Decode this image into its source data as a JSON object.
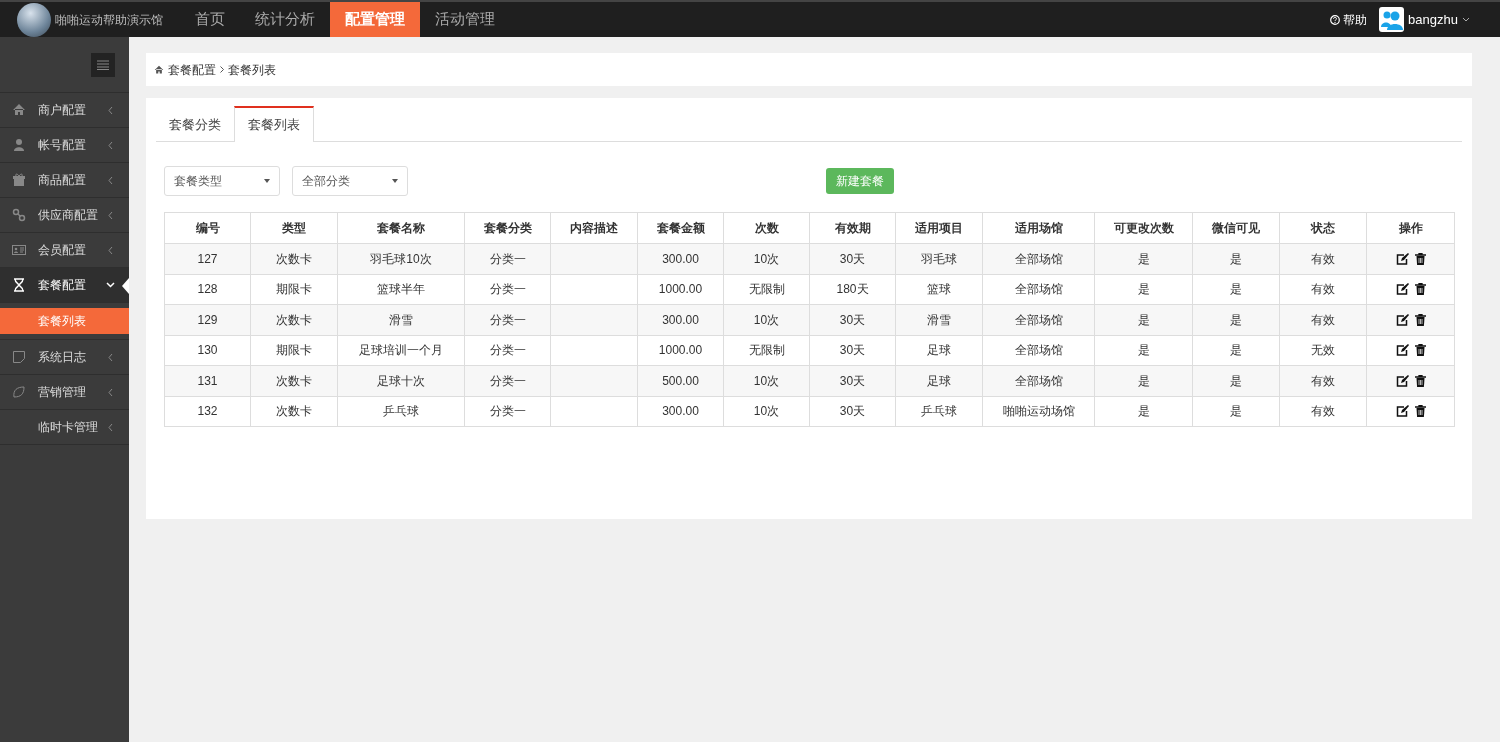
{
  "header": {
    "site_name": "啪啪运动帮助演示馆",
    "nav": [
      {
        "label": "首页",
        "selected": false
      },
      {
        "label": "统计分析",
        "selected": false
      },
      {
        "label": "配置管理",
        "selected": true
      },
      {
        "label": "活动管理",
        "selected": false
      }
    ],
    "help": "帮助",
    "user": "bangzhu"
  },
  "sidebar": {
    "items": [
      {
        "label": "商户配置",
        "expanded": false
      },
      {
        "label": "帐号配置",
        "expanded": false
      },
      {
        "label": "商品配置",
        "expanded": false
      },
      {
        "label": "供应商配置",
        "expanded": false
      },
      {
        "label": "会员配置",
        "expanded": false
      },
      {
        "label": "套餐配置",
        "expanded": true,
        "children": [
          {
            "label": "套餐列表",
            "selected": true
          }
        ]
      },
      {
        "label": "系统日志",
        "expanded": false
      },
      {
        "label": "营销管理",
        "expanded": false
      },
      {
        "label": "临时卡管理",
        "expanded": false
      }
    ]
  },
  "breadcrumb": [
    "套餐配置",
    "套餐列表"
  ],
  "tabs": [
    {
      "label": "套餐分类",
      "selected": false
    },
    {
      "label": "套餐列表",
      "selected": true
    }
  ],
  "filters": [
    {
      "value": "套餐类型"
    },
    {
      "value": "全部分类"
    }
  ],
  "new_button": "新建套餐",
  "table": {
    "columns": [
      "编号",
      "类型",
      "套餐名称",
      "套餐分类",
      "内容描述",
      "套餐金额",
      "次数",
      "有效期",
      "适用项目",
      "适用场馆",
      "可更改次数",
      "微信可见",
      "状态",
      "操作"
    ],
    "rows": [
      [
        "127",
        "次数卡",
        "羽毛球10次",
        "分类一",
        "",
        "300.00",
        "10次",
        "30天",
        "羽毛球",
        "全部场馆",
        "是",
        "是",
        "有效"
      ],
      [
        "128",
        "期限卡",
        "篮球半年",
        "分类一",
        "",
        "1000.00",
        "无限制",
        "180天",
        "篮球",
        "全部场馆",
        "是",
        "是",
        "有效"
      ],
      [
        "129",
        "次数卡",
        "滑雪",
        "分类一",
        "",
        "300.00",
        "10次",
        "30天",
        "滑雪",
        "全部场馆",
        "是",
        "是",
        "有效"
      ],
      [
        "130",
        "期限卡",
        "足球培训一个月",
        "分类一",
        "",
        "1000.00",
        "无限制",
        "30天",
        "足球",
        "全部场馆",
        "是",
        "是",
        "无效"
      ],
      [
        "131",
        "次数卡",
        "足球十次",
        "分类一",
        "",
        "500.00",
        "10次",
        "30天",
        "足球",
        "全部场馆",
        "是",
        "是",
        "有效"
      ],
      [
        "132",
        "次数卡",
        "乒乓球",
        "分类一",
        "",
        "300.00",
        "10次",
        "30天",
        "乒乓球",
        "啪啪运动场馆",
        "是",
        "是",
        "有效"
      ]
    ]
  }
}
